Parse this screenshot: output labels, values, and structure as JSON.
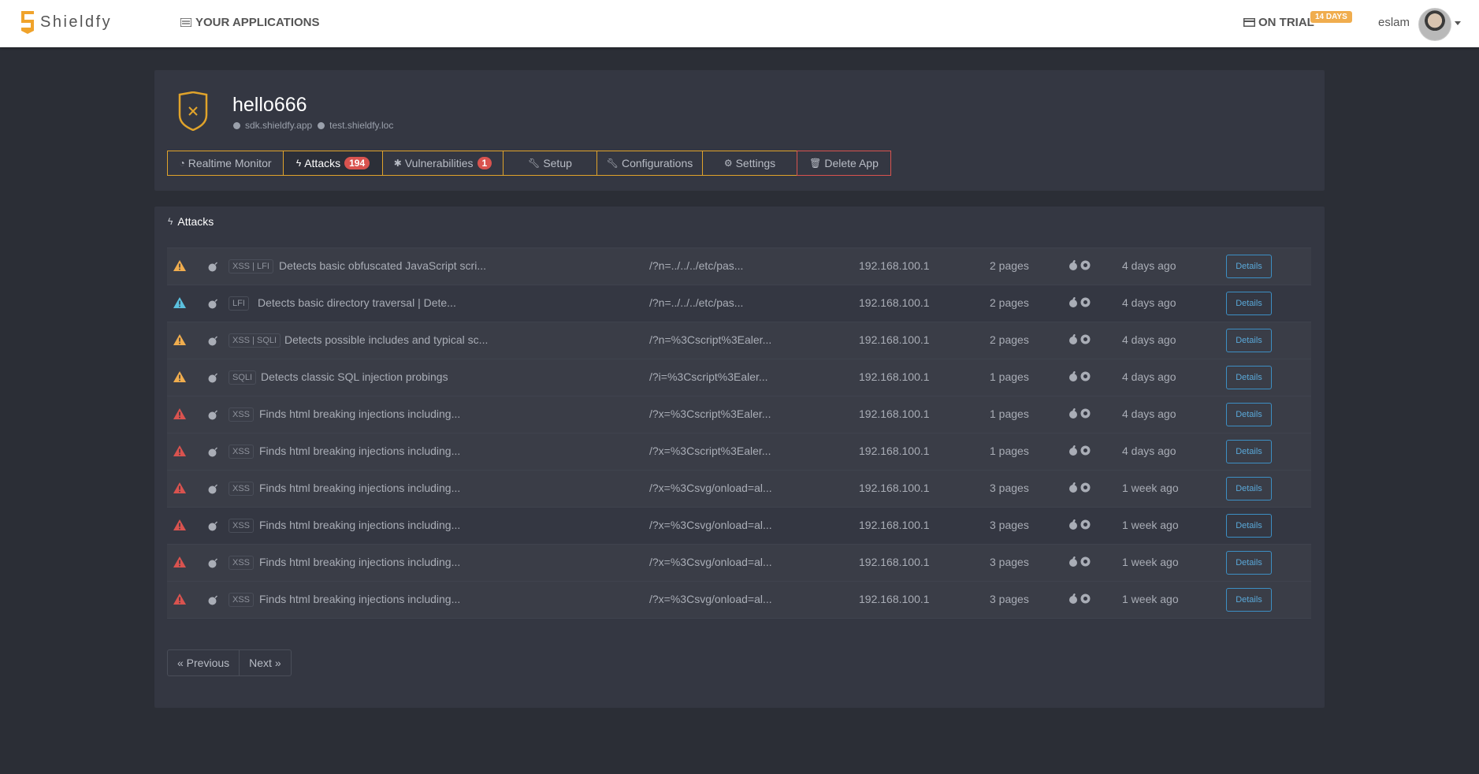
{
  "navbar": {
    "brand": "Shieldfy",
    "apps_link": "YOUR APPLICATIONS",
    "trial_label": "ON TRIAL",
    "trial_badge": "14 DAYS",
    "username": "eslam"
  },
  "app": {
    "name": "hello666",
    "domains": [
      "sdk.shieldfy.app",
      "test.shieldfy.loc"
    ],
    "tabs": [
      {
        "label": "Realtime Monitor",
        "icon": "dashboard-icon"
      },
      {
        "label": "Attacks",
        "icon": "bolt-icon",
        "badge": "194"
      },
      {
        "label": "Vulnerabilities",
        "icon": "bug-icon",
        "badge": "1"
      },
      {
        "label": "Setup",
        "icon": "wrench-icon"
      },
      {
        "label": "Configurations",
        "icon": "wrench-icon"
      },
      {
        "label": "Settings",
        "icon": "cogs-icon"
      },
      {
        "label": "Delete App",
        "icon": "trash-icon"
      }
    ]
  },
  "attacks": {
    "heading": "Attacks",
    "details_label": "Details",
    "rows": [
      {
        "severity": "warning",
        "type": "XSS | LFI",
        "description": "Detects basic obfuscated JavaScript scri...",
        "path": "/?n=../../../etc/pas...",
        "ip": "192.168.100.1",
        "pages": "2 pages",
        "time": "4 days ago"
      },
      {
        "severity": "info",
        "type": "LFI",
        "description": "Detects basic directory traversal | Dete...",
        "path": "/?n=../../../etc/pas...",
        "ip": "192.168.100.1",
        "pages": "2 pages",
        "time": "4 days ago"
      },
      {
        "severity": "warning",
        "type": "XSS | SQLI",
        "description": "Detects possible includes and typical sc...",
        "path": "/?n=%3Cscript%3Ealer...",
        "ip": "192.168.100.1",
        "pages": "2 pages",
        "time": "4 days ago"
      },
      {
        "severity": "warning",
        "type": "SQLI",
        "description": "Detects classic SQL injection probings",
        "path": "/?i=%3Cscript%3Ealer...",
        "ip": "192.168.100.1",
        "pages": "1 pages",
        "time": "4 days ago"
      },
      {
        "severity": "danger",
        "type": "XSS",
        "description": "Finds html breaking injections including...",
        "path": "/?x=%3Cscript%3Ealer...",
        "ip": "192.168.100.1",
        "pages": "1 pages",
        "time": "4 days ago"
      },
      {
        "severity": "danger",
        "type": "XSS",
        "description": "Finds html breaking injections including...",
        "path": "/?x=%3Cscript%3Ealer...",
        "ip": "192.168.100.1",
        "pages": "1 pages",
        "time": "4 days ago"
      },
      {
        "severity": "danger",
        "type": "XSS",
        "description": "Finds html breaking injections including...",
        "path": "/?x=%3Csvg/onload=al...",
        "ip": "192.168.100.1",
        "pages": "3 pages",
        "time": "1 week ago"
      },
      {
        "severity": "danger",
        "type": "XSS",
        "description": "Finds html breaking injections including...",
        "path": "/?x=%3Csvg/onload=al...",
        "ip": "192.168.100.1",
        "pages": "3 pages",
        "time": "1 week ago"
      },
      {
        "severity": "danger",
        "type": "XSS",
        "description": "Finds html breaking injections including...",
        "path": "/?x=%3Csvg/onload=al...",
        "ip": "192.168.100.1",
        "pages": "3 pages",
        "time": "1 week ago"
      },
      {
        "severity": "danger",
        "type": "XSS",
        "description": "Finds html breaking injections including...",
        "path": "/?x=%3Csvg/onload=al...",
        "ip": "192.168.100.1",
        "pages": "3 pages",
        "time": "1 week ago"
      }
    ]
  },
  "pagination": {
    "previous": "« Previous",
    "next": "Next »"
  },
  "colors": {
    "warning": "#f0ad4e",
    "info": "#5bc0de",
    "danger": "#d9534f",
    "accent": "#e0a32b"
  }
}
